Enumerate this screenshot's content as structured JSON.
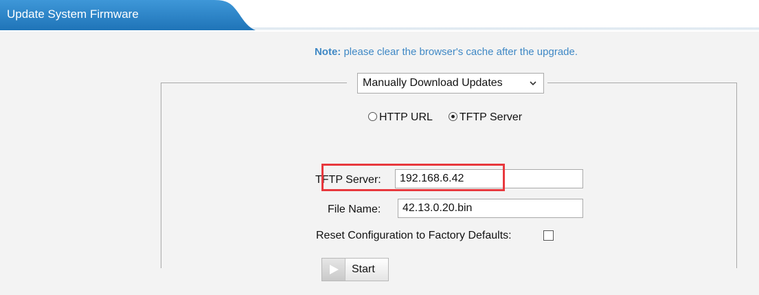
{
  "header": {
    "title": "Update System Firmware"
  },
  "note": {
    "label": "Note:",
    "text": " please clear the browser's cache after the upgrade."
  },
  "update_method": {
    "selected": "Manually Download Updates"
  },
  "protocol": {
    "options": [
      {
        "label": "HTTP URL",
        "checked": false
      },
      {
        "label": "TFTP Server",
        "checked": true
      }
    ]
  },
  "tftp_server": {
    "label": "TFTP Server:",
    "value": "192.168.6.42"
  },
  "file_name": {
    "label": "File Name:",
    "value": "42.13.0.20.bin"
  },
  "reset_config": {
    "label": "Reset Configuration to Factory Defaults:",
    "checked": false
  },
  "start_button": {
    "label": "Start"
  },
  "colors": {
    "tab_blue": "#2e86c9",
    "note_blue": "#3f88c5",
    "highlight_red": "#e8383d"
  }
}
